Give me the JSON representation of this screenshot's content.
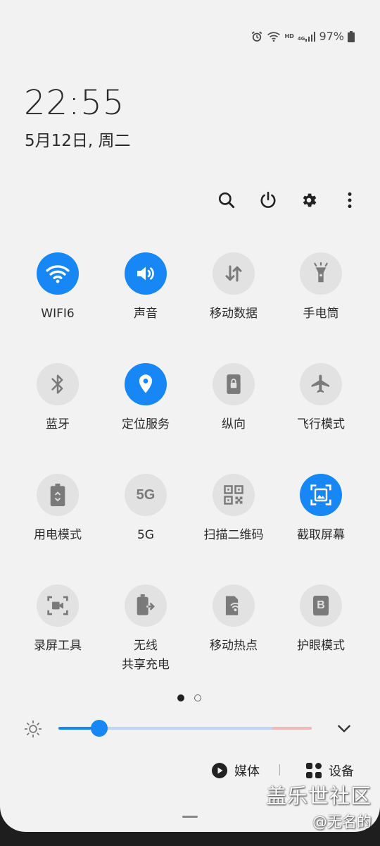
{
  "status_bar": {
    "hd": "HD",
    "network": "4G",
    "battery": "97%"
  },
  "clock": {
    "time": "22:55",
    "date": "5月12日, 周二"
  },
  "tiles": [
    {
      "label": "WIFI6",
      "on": true,
      "icon": "wifi-icon"
    },
    {
      "label": "声音",
      "on": true,
      "icon": "volume-icon"
    },
    {
      "label": "移动数据",
      "on": false,
      "icon": "mobile-data-icon"
    },
    {
      "label": "手电筒",
      "on": false,
      "icon": "flashlight-icon"
    },
    {
      "label": "蓝牙",
      "on": false,
      "icon": "bluetooth-icon"
    },
    {
      "label": "定位服务",
      "on": true,
      "icon": "location-icon"
    },
    {
      "label": "纵向",
      "on": false,
      "icon": "portrait-lock-icon"
    },
    {
      "label": "飞行模式",
      "on": false,
      "icon": "airplane-icon"
    },
    {
      "label": "用电模式",
      "on": false,
      "icon": "power-mode-icon"
    },
    {
      "label": "5G",
      "on": false,
      "icon": "5g-icon",
      "glyph": "5G"
    },
    {
      "label": "扫描二维码",
      "on": false,
      "icon": "qr-code-icon"
    },
    {
      "label": "截取屏幕",
      "on": true,
      "icon": "screenshot-icon"
    },
    {
      "label": "录屏工具",
      "on": false,
      "icon": "screen-recorder-icon"
    },
    {
      "label_line1": "无线",
      "label_line2": "共享充电",
      "on": false,
      "icon": "wireless-powershare-icon"
    },
    {
      "label": "移动热点",
      "on": false,
      "icon": "hotspot-icon"
    },
    {
      "label": "护眼模式",
      "on": false,
      "icon": "eye-comfort-icon",
      "glyph": "B"
    }
  ],
  "pager": {
    "pages": 2,
    "current": 1
  },
  "brightness": {
    "level": 0.16
  },
  "bottom": {
    "media_label": "媒体",
    "devices_label": "设备"
  },
  "watermark": {
    "line1": "盖乐世社区",
    "line2": "@无名的"
  },
  "colors": {
    "accent": "#1787f5",
    "tile_off": "#e2e2e2",
    "panel_bg": "#f2f2f2"
  }
}
